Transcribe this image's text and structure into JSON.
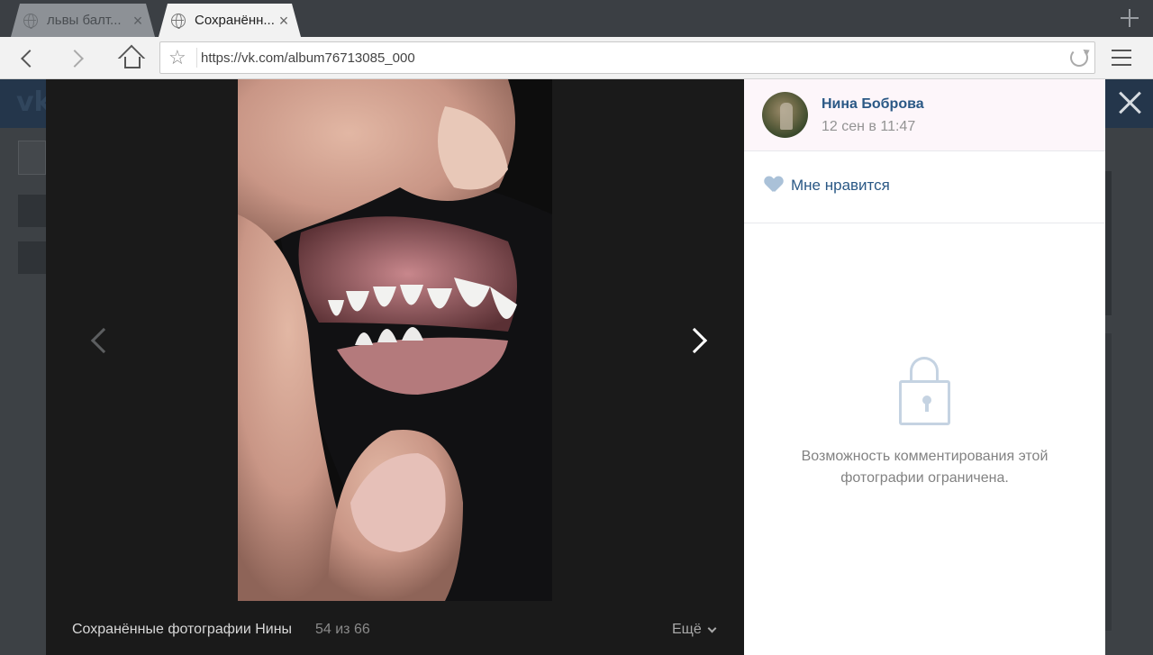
{
  "browser": {
    "tabs": [
      {
        "label": "львы балт...",
        "active": false,
        "close": "×"
      },
      {
        "label": "Сохранённ...",
        "active": true,
        "close": "×"
      }
    ],
    "new_tab_icon": "plus-icon",
    "url": "https://vk.com/album76713085_000"
  },
  "viewer": {
    "album_title": "Сохранённые фотографии Нины",
    "counter": "54 из 66",
    "more_label": "Ещё",
    "background": "#1a1a1a",
    "prev_icon": "chevron-left-icon",
    "next_icon": "chevron-right-icon"
  },
  "panel": {
    "author_name": "Нина Боброва",
    "date": "12 сен в 11:47",
    "like_label": "Мне нравится",
    "comments_restricted": "Возможность комментирования этой фотографии ограничена.",
    "link_color": "#2a5885",
    "lock_icon": "lock-icon"
  }
}
